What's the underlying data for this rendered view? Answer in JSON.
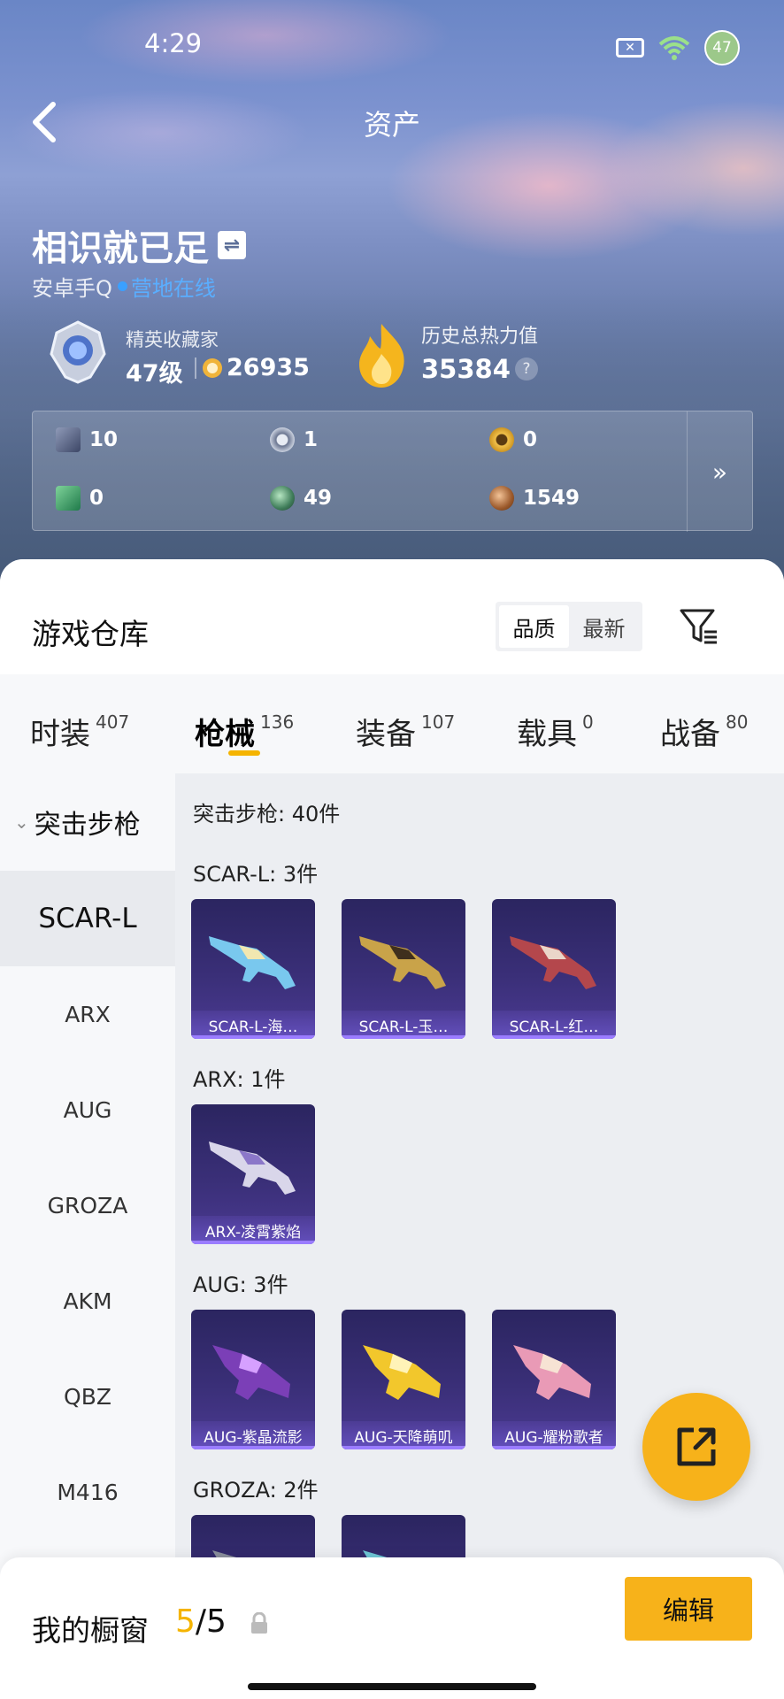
{
  "status_bar": {
    "time": "4:29",
    "battery": "47",
    "wifi_badge": "6"
  },
  "header": {
    "title": "资产"
  },
  "profile": {
    "username": "相识就已足",
    "platform": "安卓手Q",
    "online_status": "营地在线",
    "rank_title": "精英收藏家",
    "level": "47级",
    "coins": "26935",
    "heat_title": "历史总热力值",
    "heat_value": "35384",
    "help": "?"
  },
  "stats": [
    {
      "icon": "card-icon",
      "value": "10"
    },
    {
      "icon": "silver-coin-icon",
      "value": "1"
    },
    {
      "icon": "gold-token-icon",
      "value": "0"
    },
    {
      "icon": "green-card-icon",
      "value": "0"
    },
    {
      "icon": "green-orb-icon",
      "value": "49"
    },
    {
      "icon": "bronze-coin-icon",
      "value": "1549"
    }
  ],
  "stats_more": "»",
  "warehouse": {
    "title": "游戏仓库",
    "sort_options": [
      "品质",
      "最新"
    ],
    "sort_active": "品质"
  },
  "categories": [
    {
      "label": "时装",
      "count": "407"
    },
    {
      "label": "枪械",
      "count": "136",
      "active": true
    },
    {
      "label": "装备",
      "count": "107"
    },
    {
      "label": "载具",
      "count": "0"
    },
    {
      "label": "战备",
      "count": "80"
    }
  ],
  "side_nav": {
    "group": "突击步枪",
    "items": [
      "SCAR-L",
      "ARX",
      "AUG",
      "GROZA",
      "AKM",
      "QBZ",
      "M416"
    ],
    "active": "SCAR-L"
  },
  "content": {
    "group_summary": "突击步枪: 40件",
    "sections": [
      {
        "title": "SCAR-L: 3件",
        "items": [
          "SCAR-L-海…",
          "SCAR-L-玉…",
          "SCAR-L-红…"
        ]
      },
      {
        "title": "ARX: 1件",
        "items": [
          "ARX-凌霄紫焰"
        ]
      },
      {
        "title": "AUG: 3件",
        "items": [
          "AUG-紫晶流影",
          "AUG-天降萌叽",
          "AUG-耀粉歌者"
        ]
      },
      {
        "title": "GROZA: 2件",
        "items": [
          "",
          ""
        ]
      }
    ]
  },
  "bottom": {
    "showcase_label": "我的橱窗",
    "showcase_current": "5",
    "showcase_total": "/5",
    "edit_label": "编辑"
  },
  "colors": {
    "accent": "#f7b21a",
    "online": "#3aa0ff",
    "card_bg": "#3a2f78"
  }
}
